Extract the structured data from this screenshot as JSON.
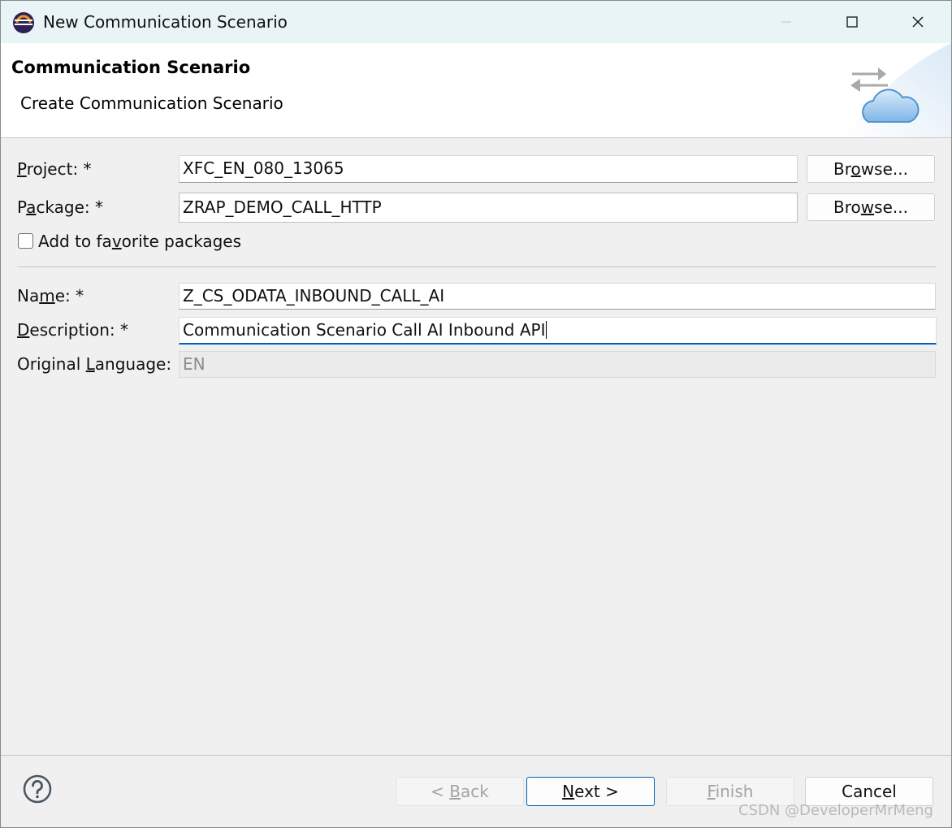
{
  "window": {
    "title": "New Communication Scenario",
    "icon": "eclipse-icon"
  },
  "banner": {
    "title": "Communication Scenario",
    "subtitle": "Create Communication Scenario",
    "graphic": "cloud-transfer-icon"
  },
  "form": {
    "project": {
      "label_pre": "",
      "label_mn": "P",
      "label_post": "roject: *",
      "value": "XFC_EN_080_13065",
      "browse_pre": "Br",
      "browse_mn": "o",
      "browse_post": "wse..."
    },
    "package": {
      "label_pre": "P",
      "label_mn": "a",
      "label_post": "ckage: *",
      "value": "ZRAP_DEMO_CALL_HTTP",
      "browse_pre": "Bro",
      "browse_mn": "w",
      "browse_post": "se..."
    },
    "favorite": {
      "label_pre": "Add to fa",
      "label_mn": "v",
      "label_post": "orite packages",
      "checked": false
    },
    "name": {
      "label_pre": "Na",
      "label_mn": "m",
      "label_post": "e: *",
      "value": "Z_CS_ODATA_INBOUND_CALL_AI"
    },
    "description": {
      "label_pre": "",
      "label_mn": "D",
      "label_post": "escription: *",
      "value": "Communication Scenario Call AI Inbound API"
    },
    "language": {
      "label_pre": "Original ",
      "label_mn": "L",
      "label_post": "anguage:",
      "value": "EN"
    }
  },
  "footer": {
    "back": {
      "pre": "< ",
      "mn": "B",
      "post": "ack",
      "enabled": false
    },
    "next": {
      "pre": "",
      "mn": "N",
      "post": "ext >",
      "enabled": true
    },
    "finish": {
      "pre": "",
      "mn": "F",
      "post": "inish",
      "enabled": false
    },
    "cancel": {
      "label": "Cancel"
    }
  },
  "watermark": "CSDN @DeveloperMrMeng",
  "colors": {
    "titlebar": "#e8f4f5",
    "focus": "#005fb8",
    "dialog_bg": "#f0f0f0"
  }
}
